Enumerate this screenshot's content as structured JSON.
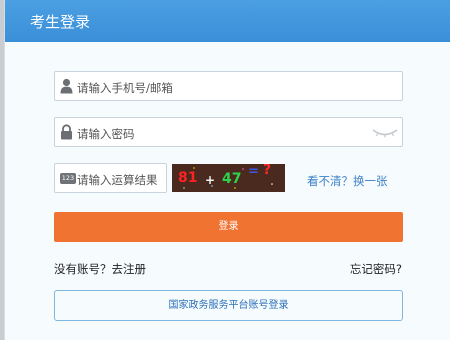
{
  "header": {
    "title": "考生登录"
  },
  "form": {
    "phone_placeholder": "请输入手机号/邮箱",
    "password_placeholder": "请输入密码",
    "math_badge": "123",
    "math_placeholder": "请输入运算结果",
    "captcha": {
      "first": "81",
      "op": "+",
      "second": "47",
      "eq": "=",
      "q": "?"
    },
    "refresh_label": "看不清？换一张",
    "login_label": "登录",
    "register_label": "没有账号？去注册",
    "forgot_label": "忘记密码?",
    "gov_login_label": "国家政务服务平台账号登录"
  },
  "colors": {
    "header": "#3a8fd8",
    "login_button": "#f07332",
    "link": "#3d82c8",
    "gov_border": "#7fb7df"
  },
  "icons": {
    "phone_field": "user-icon",
    "password_field": "lock-icon",
    "password_toggle": "eye-closed-icon"
  }
}
